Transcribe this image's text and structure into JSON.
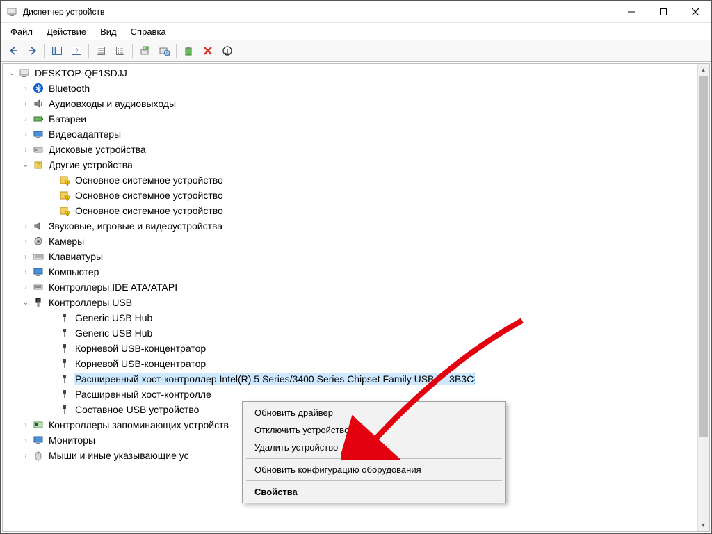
{
  "window": {
    "title": "Диспетчер устройств"
  },
  "menu": {
    "file": "Файл",
    "action": "Действие",
    "view": "Вид",
    "help": "Справка"
  },
  "tree": {
    "root": "DESKTOP-QE1SDJJ",
    "bluetooth": "Bluetooth",
    "audio": "Аудиовходы и аудиовыходы",
    "batteries": "Батареи",
    "video_adapters": "Видеоадаптеры",
    "disk_drives": "Дисковые устройства",
    "other_devices": "Другие устройства",
    "base_system_device_1": "Основное системное устройство",
    "base_system_device_2": "Основное системное устройство",
    "base_system_device_3": "Основное системное устройство",
    "sound_video_game": "Звуковые, игровые и видеоустройства",
    "cameras": "Камеры",
    "keyboards": "Клавиатуры",
    "computer": "Компьютер",
    "ide_ata": "Контроллеры IDE ATA/ATAPI",
    "usb_controllers": "Контроллеры USB",
    "generic_usb_hub_1": "Generic USB Hub",
    "generic_usb_hub_2": "Generic USB Hub",
    "root_usb_hub_1": "Корневой USB-концентратор",
    "root_usb_hub_2": "Корневой USB-концентратор",
    "intel_usb_controller": "Расширенный хост-контроллер Intel(R) 5 Series/3400 Series Chipset Family USB — 3B3C",
    "intel_usb_controller_2": "Расширенный хост-контролле",
    "composite_usb": "Составное USB устройство",
    "storage_controllers": "Контроллеры запоминающих устройств",
    "monitors": "Мониторы",
    "mice": "Мыши и иные указывающие ус"
  },
  "context_menu": {
    "update_driver": "Обновить драйвер",
    "disable_device": "Отключить устройство",
    "uninstall_device": "Удалить устройство",
    "scan_hardware": "Обновить конфигурацию оборудования",
    "properties": "Свойства"
  }
}
